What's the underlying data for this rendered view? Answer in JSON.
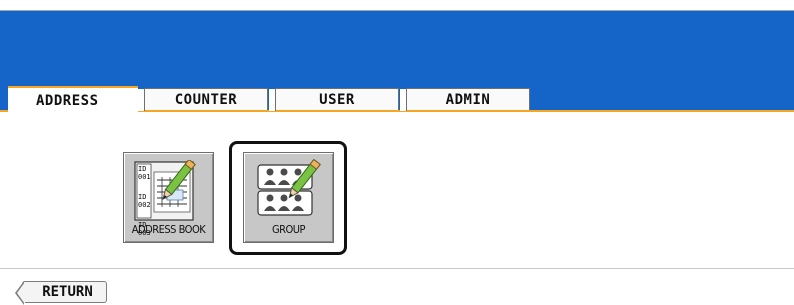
{
  "tabs": [
    {
      "label": "ADDRESS",
      "active": true
    },
    {
      "label": "COUNTER",
      "active": false
    },
    {
      "label": "USER",
      "active": false
    },
    {
      "label": "ADMIN",
      "active": false
    }
  ],
  "buttons": {
    "address_book_label": "ADDRESS BOOK",
    "group_label": "GROUP",
    "return_label": "RETURN"
  },
  "address_book_icon": {
    "id_lines": [
      "ID 001",
      "ID 002",
      "ID 003"
    ]
  },
  "colors": {
    "header_blue": "#1565c8",
    "tab_accent": "#f6a623",
    "button_gray": "#c7c7c7"
  },
  "icons": {
    "address_book": "address-book-icon",
    "group": "group-icon",
    "return_arrow": "back-arrow-icon"
  }
}
